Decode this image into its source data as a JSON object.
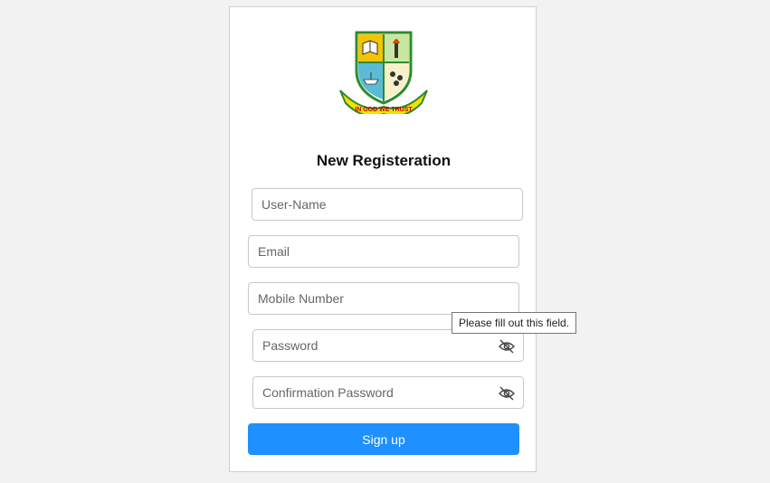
{
  "logo": {
    "motto": "IN GOD WE TRUST"
  },
  "form": {
    "title": "New Registeration",
    "username_placeholder": "User-Name",
    "email_placeholder": "Email",
    "mobile_placeholder": "Mobile Number",
    "password_placeholder": "Password",
    "confirm_placeholder": "Confirmation Password",
    "signup_label": "Sign up"
  },
  "tooltip": {
    "text": "Please fill out this field."
  },
  "icons": {
    "password_toggle": "eye-slash-icon"
  },
  "colors": {
    "primary": "#1e90ff",
    "background": "#f2f2f2",
    "card": "#ffffff"
  }
}
